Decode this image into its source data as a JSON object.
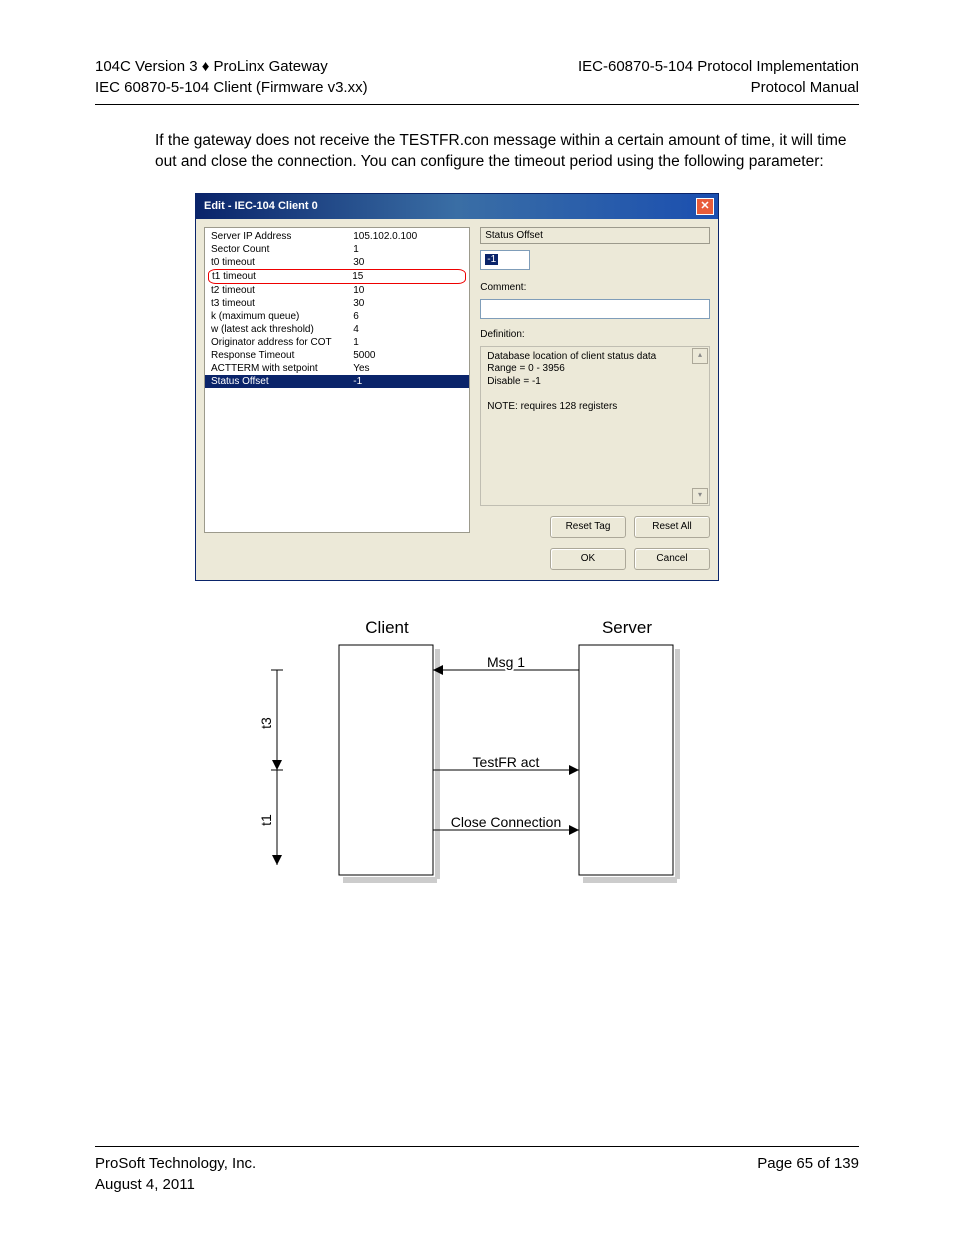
{
  "header": {
    "left_line1": "104C Version 3 ♦ ProLinx Gateway",
    "left_line2": "IEC 60870-5-104 Client (Firmware v3.xx)",
    "right_line1": "IEC-60870-5-104 Protocol Implementation",
    "right_line2": "Protocol Manual"
  },
  "body_text": "If the gateway does not receive the TESTFR.con message within a certain amount of time, it will time out and close the connection. You can configure the timeout period using the following parameter:",
  "dialog": {
    "title": "Edit - IEC-104 Client 0",
    "params": [
      {
        "k": "Server IP Address",
        "v": "105.102.0.100",
        "sel": false,
        "circled": false
      },
      {
        "k": "Sector Count",
        "v": "1",
        "sel": false,
        "circled": false
      },
      {
        "k": "t0 timeout",
        "v": "30",
        "sel": false,
        "circled": false
      },
      {
        "k": "t1 timeout",
        "v": "15",
        "sel": false,
        "circled": true
      },
      {
        "k": "t2 timeout",
        "v": "10",
        "sel": false,
        "circled": false
      },
      {
        "k": "t3 timeout",
        "v": "30",
        "sel": false,
        "circled": false
      },
      {
        "k": "k (maximum queue)",
        "v": "6",
        "sel": false,
        "circled": false
      },
      {
        "k": "w (latest ack threshold)",
        "v": "4",
        "sel": false,
        "circled": false
      },
      {
        "k": "Originator address for COT",
        "v": "1",
        "sel": false,
        "circled": false
      },
      {
        "k": "Response Timeout",
        "v": "5000",
        "sel": false,
        "circled": false
      },
      {
        "k": "ACTTERM with setpoint",
        "v": "Yes",
        "sel": false,
        "circled": false
      },
      {
        "k": "Status Offset",
        "v": "-1",
        "sel": true,
        "circled": false
      }
    ],
    "right": {
      "field_label": "Status Offset",
      "field_value": "-1",
      "comment_label": "Comment:",
      "comment_value": "",
      "definition_label": "Definition:",
      "definition_text": "Database location of client status data\nRange = 0 - 3956\nDisable = -1\n\nNOTE: requires 128 registers"
    },
    "buttons": {
      "reset_tag": "Reset Tag",
      "reset_all": "Reset All",
      "ok": "OK",
      "cancel": "Cancel"
    }
  },
  "diagram": {
    "client_label": "Client",
    "server_label": "Server",
    "msg1": "Msg 1",
    "msg2": "TestFR act",
    "msg3": "Close Connection",
    "t3": "t3",
    "t1": "t1"
  },
  "footer": {
    "left_line1": "ProSoft Technology, Inc.",
    "left_line2": "August 4, 2011",
    "right": "Page 65 of 139"
  }
}
